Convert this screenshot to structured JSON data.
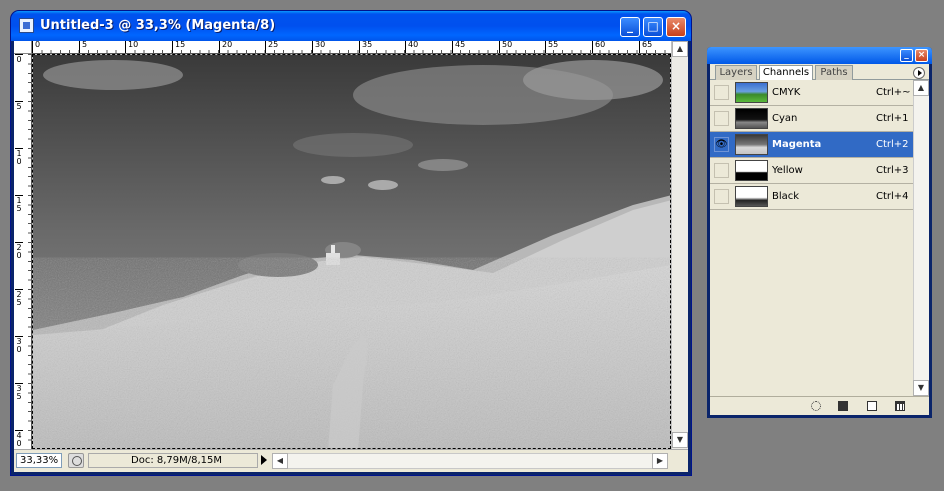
{
  "document": {
    "title": "Untitled-3 @ 33,3% (Magenta/8)",
    "ruler_h": [
      "0",
      "5",
      "10",
      "15",
      "20",
      "25",
      "30",
      "35",
      "40",
      "45",
      "50",
      "55",
      "60",
      "65"
    ],
    "ruler_v": [
      "0",
      "5",
      "10",
      "15",
      "20",
      "25",
      "30",
      "35",
      "40"
    ],
    "zoom": "33,33%",
    "doc_info": "Doc: 8,79M/8,15M",
    "buttons": {
      "minimize": "_",
      "maximize": "□",
      "close": "×"
    }
  },
  "panel": {
    "tabs": [
      "Layers",
      "Channels",
      "Paths"
    ],
    "active_tab": "Channels",
    "channels": [
      {
        "name": "CMYK",
        "shortcut": "Ctrl+~",
        "visible": false,
        "selected": false
      },
      {
        "name": "Cyan",
        "shortcut": "Ctrl+1",
        "visible": false,
        "selected": false
      },
      {
        "name": "Magenta",
        "shortcut": "Ctrl+2",
        "visible": true,
        "selected": true
      },
      {
        "name": "Yellow",
        "shortcut": "Ctrl+3",
        "visible": false,
        "selected": false
      },
      {
        "name": "Black",
        "shortcut": "Ctrl+4",
        "visible": false,
        "selected": false
      }
    ],
    "eye_glyph": "👁",
    "footer_icons": [
      "load-selection-icon",
      "save-selection-icon",
      "new-channel-icon",
      "delete-channel-icon"
    ]
  },
  "colors": {
    "titlebar": "#0055ea",
    "selection": "#316ac5",
    "panel_bg": "#ece9d8",
    "desktop": "#808080"
  }
}
